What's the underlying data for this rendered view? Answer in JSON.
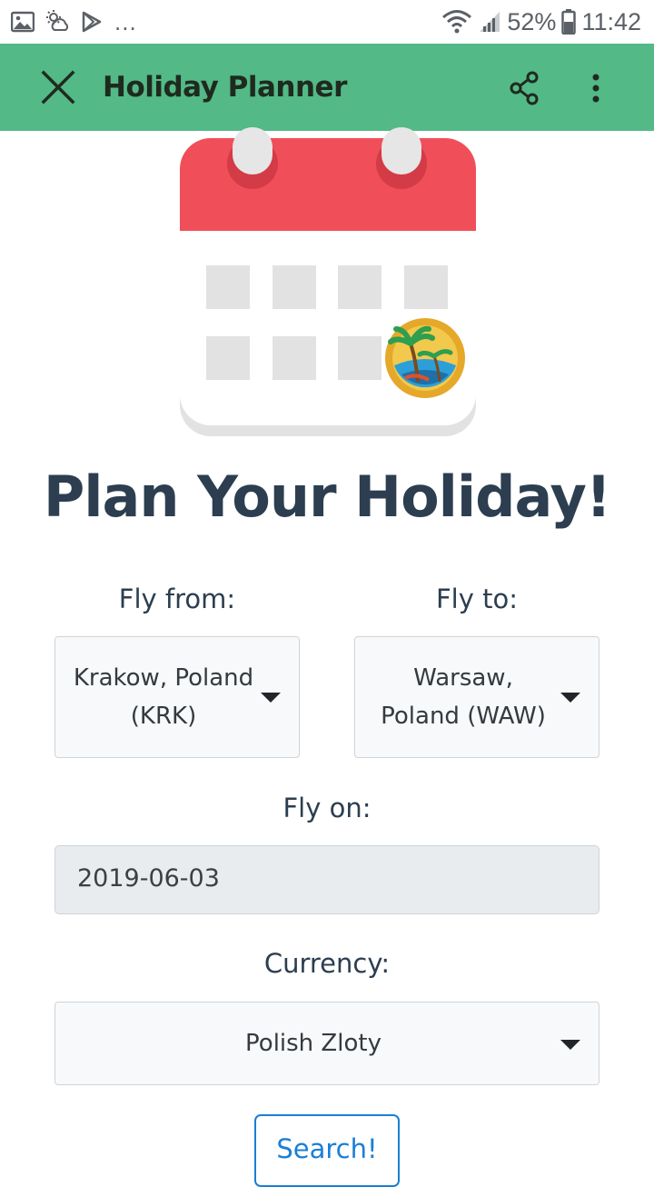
{
  "status_bar": {
    "overflow": "...",
    "battery": "52%",
    "time": "11:42",
    "icons": [
      "image-icon",
      "weather-icon",
      "play-store-icon",
      "wifi-icon",
      "signal-icon",
      "battery-icon"
    ]
  },
  "app_bar": {
    "title": "Holiday Planner",
    "icons": [
      "close-icon",
      "share-icon",
      "more-vert-icon"
    ]
  },
  "colors": {
    "app_bar": "#53b987",
    "heading": "#2c3e50",
    "calendar_top": "#f04f5a",
    "search_accent": "#1a7fd6",
    "date_input_bg": "#e9ecef"
  },
  "hero": {
    "illustration": "calendar-with-beach-badge"
  },
  "form": {
    "heading": "Plan Your Holiday!",
    "fly_from": {
      "label": "Fly from:",
      "line1": "Krakow, Poland",
      "line2": "(KRK)"
    },
    "fly_to": {
      "label": "Fly to:",
      "line1": "Warsaw,",
      "line2": "Poland (WAW)"
    },
    "fly_on": {
      "label": "Fly on:",
      "value": "2019-06-03"
    },
    "currency": {
      "label": "Currency:",
      "value": "Polish Zloty"
    },
    "search_label": "Search!"
  }
}
